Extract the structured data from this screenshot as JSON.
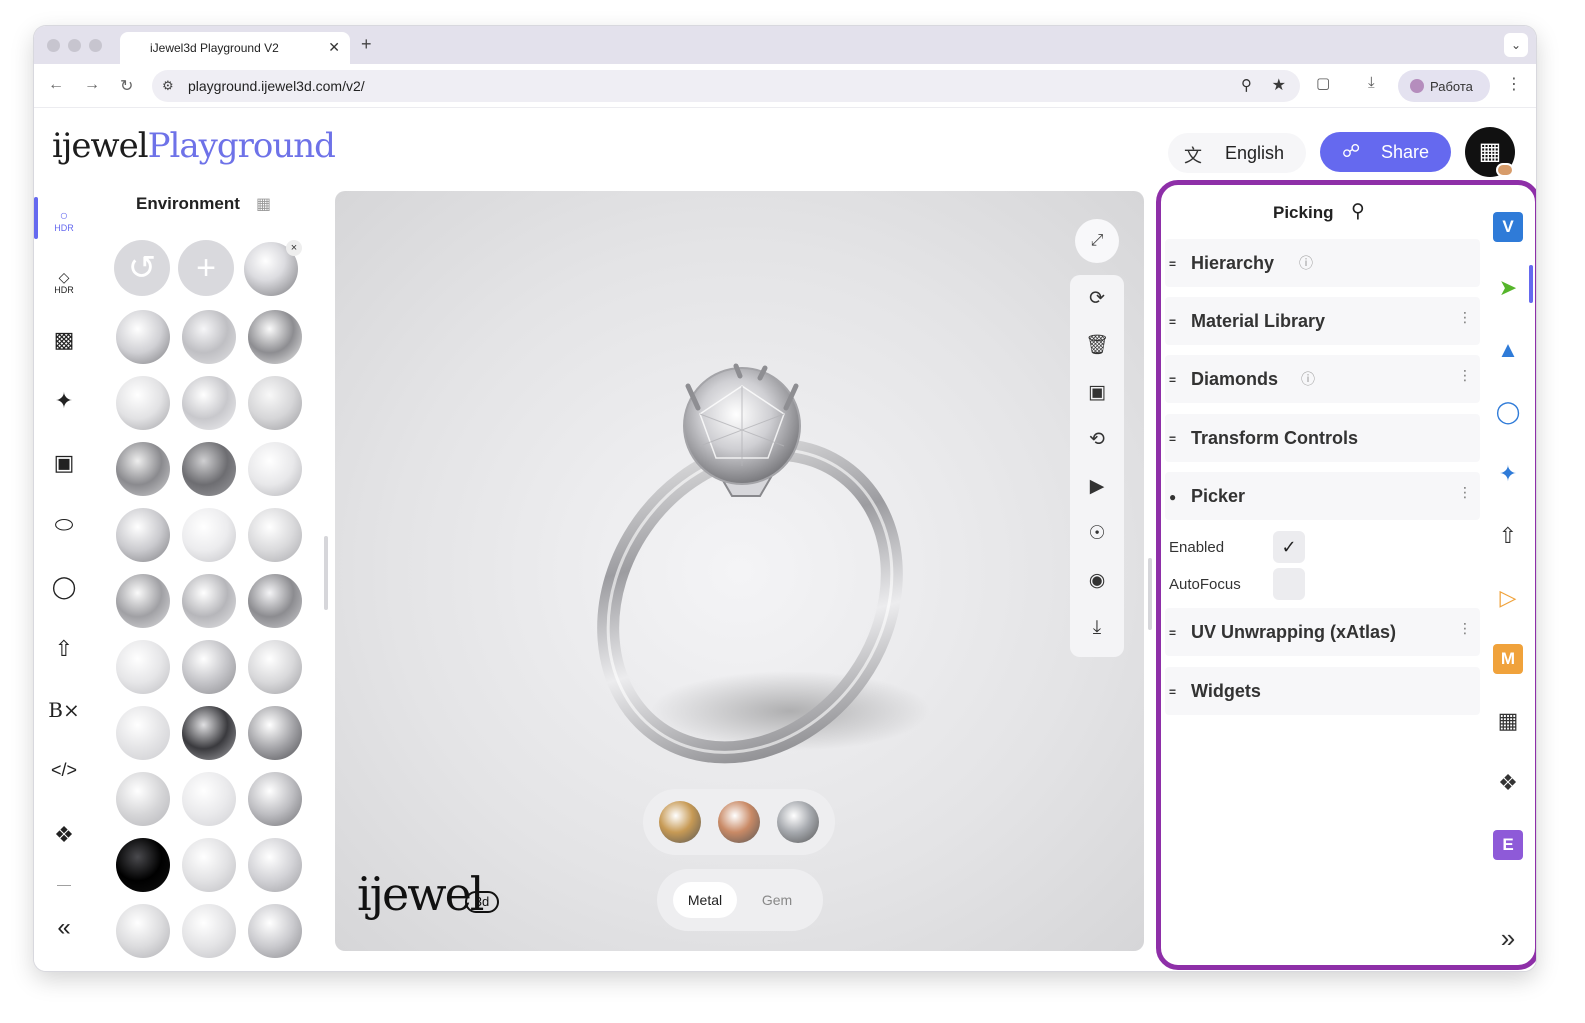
{
  "browser": {
    "tab_title": "iJewel3d Playground V2",
    "tab_close": "✕",
    "new_tab": "+",
    "url": "playground.ijewel3d.com/v2/",
    "profile_label": "Работа"
  },
  "header": {
    "logo_part1": "ijewel",
    "logo_part2": "Playground",
    "language_label": "English",
    "share_label": "Share"
  },
  "left_rail": {
    "items": [
      {
        "name": "hdr-environment",
        "sub": "HDR"
      },
      {
        "name": "hdr-diamond",
        "sub": "HDR"
      }
    ]
  },
  "environment": {
    "title": "Environment"
  },
  "viewport": {
    "swatches": [
      "#c79a55",
      "#c98a66",
      "#a7aaaf"
    ],
    "toggle_metal": "Metal",
    "toggle_gem": "Gem",
    "logo_text": "ijewel",
    "logo_badge": "3d"
  },
  "right_panel": {
    "title": "Picking",
    "sections": [
      {
        "label": "Hierarchy"
      },
      {
        "label": "Material Library"
      },
      {
        "label": "Diamonds"
      },
      {
        "label": "Transform Controls"
      },
      {
        "label": "Picker"
      },
      {
        "label": "UV Unwrapping (xAtlas)"
      },
      {
        "label": "Widgets"
      }
    ],
    "picker_fields": {
      "enabled_label": "Enabled",
      "autofocus_label": "AutoFocus",
      "enabled_checked": true,
      "autofocus_checked": false
    }
  },
  "plugin_rail": {
    "badges": {
      "v": "V",
      "m": "M",
      "e": "E"
    }
  },
  "colors": {
    "accent": "#6569ef",
    "highlight_border": "#8e2fa8",
    "plugin_v": "#2f7bd8",
    "plugin_m": "#f0a23b",
    "plugin_e": "#8e5ad8"
  }
}
